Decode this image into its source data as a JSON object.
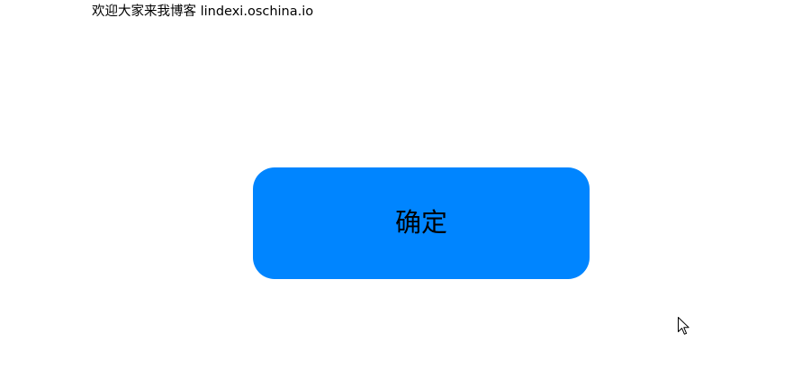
{
  "window": {
    "welcome_text": "欢迎大家来我博客 lindexi.oschina.io"
  },
  "main": {
    "confirm_button_label": "确定"
  },
  "colors": {
    "background": "#FFFFFF",
    "button_fill": "#0085FF",
    "text": "#000000"
  },
  "icons": {
    "cursor": "mouse-pointer-icon"
  }
}
